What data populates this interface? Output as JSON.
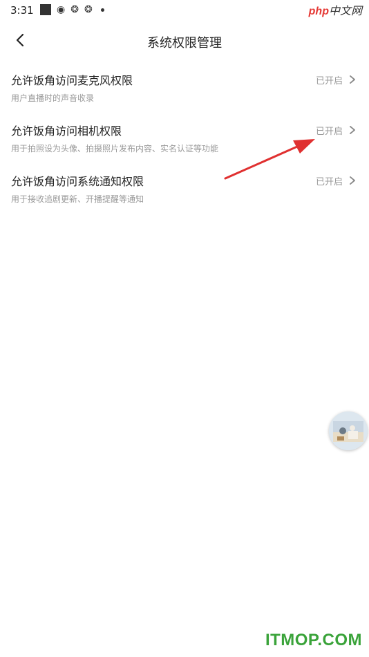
{
  "status_bar": {
    "time": "3:31",
    "icons": [
      "stop-square-icon",
      "weibo-icon",
      "app-icon",
      "app-icon",
      "dot-icon"
    ]
  },
  "watermark_top": {
    "php": "php",
    "cn": "中文网"
  },
  "header": {
    "title": "系统权限管理"
  },
  "permissions": [
    {
      "title": "允许饭角访问麦克风权限",
      "desc": "用户直播时的声音收录",
      "status": "已开启"
    },
    {
      "title": "允许饭角访问相机权限",
      "desc": "用于拍照设为头像、拍摄照片发布内容、实名认证等功能",
      "status": "已开启"
    },
    {
      "title": "允许饭角访问系统通知权限",
      "desc": "用于接收追剧更新、开播提醒等通知",
      "status": "已开启"
    }
  ],
  "watermark_bottom": "ITMOP.COM",
  "colors": {
    "annotation_arrow": "#e03030",
    "watermark_green": "#3aa33a"
  }
}
